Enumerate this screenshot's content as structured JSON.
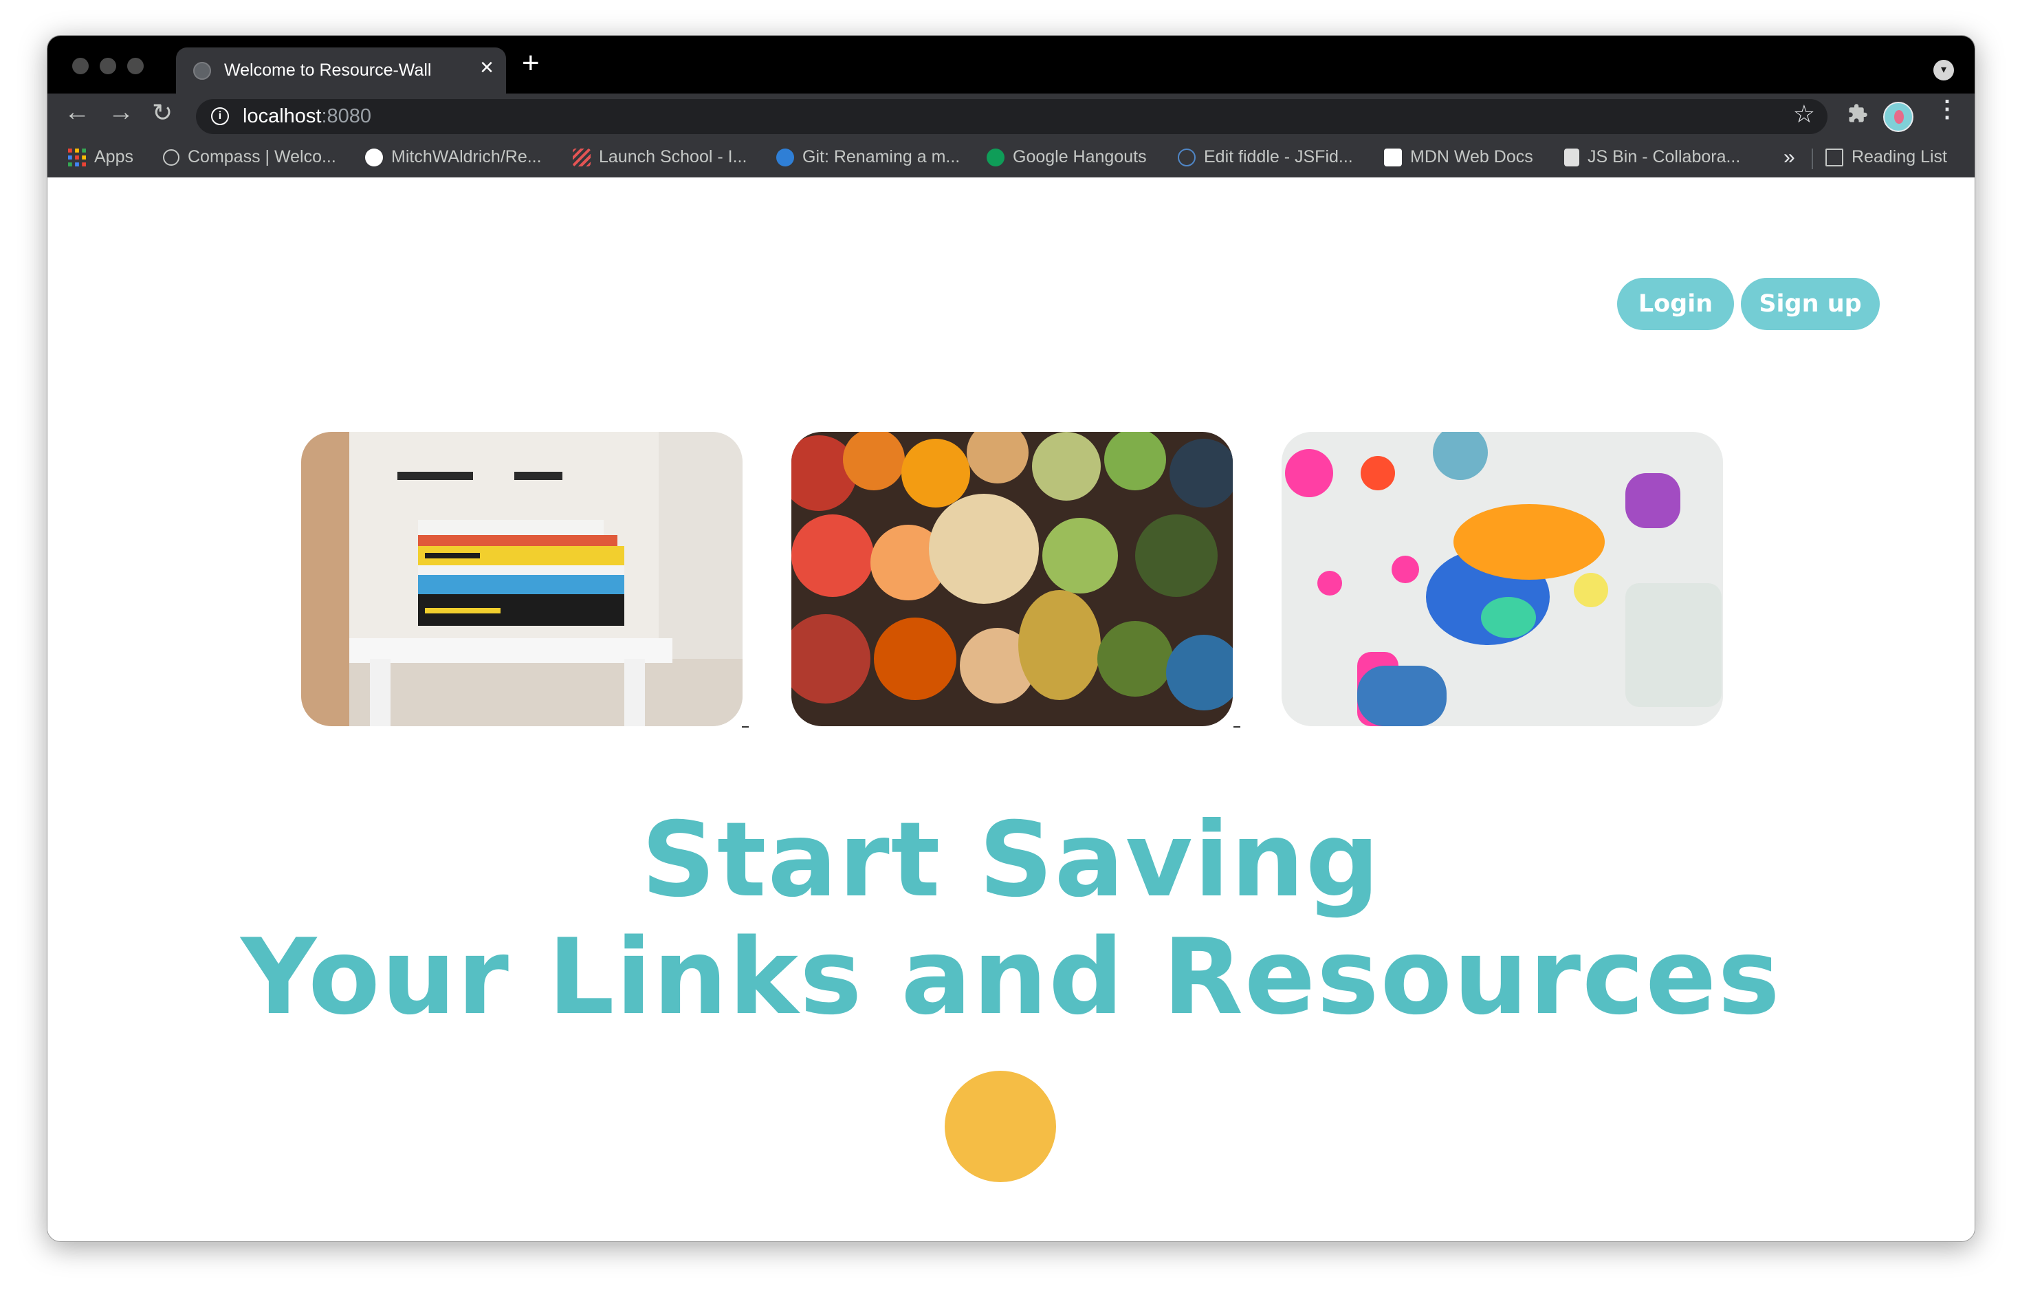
{
  "browser": {
    "tab_title": "Welcome to Resource-Wall",
    "tab_close": "×",
    "new_tab": "+",
    "url_host": "localhost",
    "url_port": ":8080",
    "bookmarks": [
      {
        "label": "Apps",
        "icon": "apps-grid-icon"
      },
      {
        "label": "Compass | Welco...",
        "icon": "compass-icon"
      },
      {
        "label": "MitchWAldrich/Re...",
        "icon": "github-icon"
      },
      {
        "label": "Launch School - I...",
        "icon": "launch-school-icon"
      },
      {
        "label": "Git: Renaming a m...",
        "icon": "git-icon"
      },
      {
        "label": "Google Hangouts",
        "icon": "hangouts-icon"
      },
      {
        "label": "Edit fiddle - JSFid...",
        "icon": "jsfiddle-icon"
      },
      {
        "label": "MDN Web Docs",
        "icon": "mdn-icon"
      },
      {
        "label": "JS Bin - Collabora...",
        "icon": "jsbin-icon"
      }
    ],
    "bookmarks_more": "»",
    "reading_list": "Reading List"
  },
  "page": {
    "login_label": "Login",
    "signup_label": "Sign up",
    "hero_line1": "Start Saving",
    "hero_line2": "Your Links and Resources",
    "images": [
      "stack-of-books-image",
      "food-spread-image",
      "child-painting-image"
    ]
  },
  "colors": {
    "accent": "#56bfc3",
    "button": "#74cdd4",
    "dot": "#f5bd45"
  }
}
